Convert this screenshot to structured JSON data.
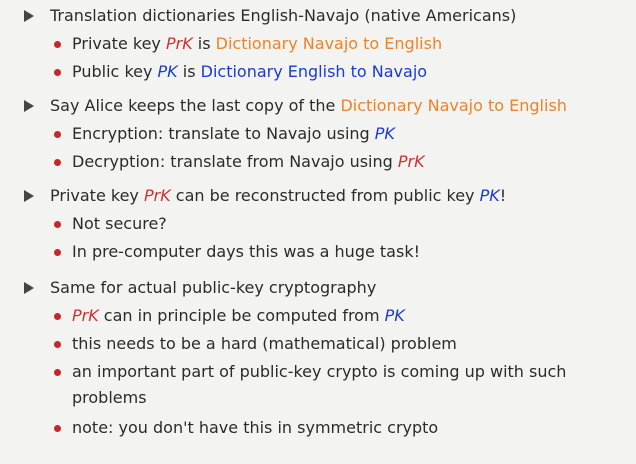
{
  "slide": {
    "section1": {
      "heading": "Translation dictionaries English-Navajo (native Americans)",
      "bullets": [
        {
          "prefix": "Private key ",
          "key": "PrK",
          "mid": " is ",
          "value": "Dictionary Navajo to English"
        },
        {
          "prefix": "Public key ",
          "key": "PK",
          "mid": " is ",
          "value": "Dictionary English to Navajo"
        }
      ]
    },
    "section2": {
      "heading_prefix": "Say Alice keeps the last copy of the ",
      "heading_value": "Dictionary Navajo to English",
      "bullets": [
        {
          "prefix": "Encryption: translate to Navajo using ",
          "key": "PK"
        },
        {
          "prefix": "Decryption: translate from Navajo using ",
          "key": "PrK"
        }
      ]
    },
    "section3": {
      "heading_a": "Private key ",
      "heading_key1": "PrK",
      "heading_b": " can be reconstructed from public key ",
      "heading_key2": "PK",
      "heading_c": "!",
      "bullets": [
        "Not secure?",
        "In pre-computer days this was a huge task!"
      ]
    },
    "section4": {
      "heading": "Same for actual public-key cryptography",
      "bullet1_key1": "PrK",
      "bullet1_mid": " can in principle be computed from ",
      "bullet1_key2": "PK",
      "bullets": [
        "this needs to be a hard (mathematical) problem",
        "an important part of public-key crypto is coming up with such",
        "problems",
        "note: you don't have this in symmetric crypto"
      ]
    }
  },
  "colors": {
    "background": "#f3f3f1",
    "text": "#2b2b2b",
    "key_red": "#d32f2f",
    "key_blue": "#1a3bd1",
    "dictionary_orange": "#f08226",
    "bullet": "#c62828",
    "triangle": "#444444"
  },
  "icons": {
    "level1": "triangle-bullet-icon",
    "level2": "round-bullet-icon"
  }
}
